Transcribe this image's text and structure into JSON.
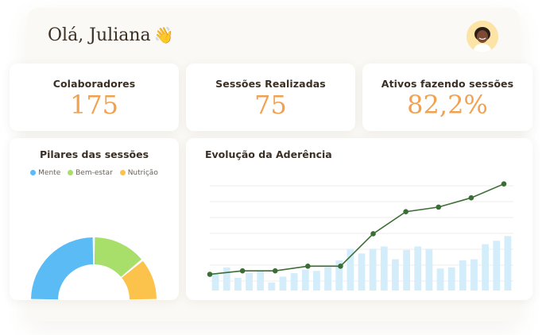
{
  "header": {
    "greeting": "Olá, Juliana",
    "wave_icon": "👋"
  },
  "kpis": [
    {
      "label": "Colaboradores",
      "value": "175"
    },
    {
      "label": "Sessões Realizadas",
      "value": "75"
    },
    {
      "label": "Ativos fazendo sessões",
      "value": "82,2%"
    }
  ],
  "pilares": {
    "title": "Pilares das sessões",
    "legend": [
      {
        "label": "Mente",
        "color": "#5bbcf5"
      },
      {
        "label": "Bem-estar",
        "color": "#a8df6b"
      },
      {
        "label": "Nutrição",
        "color": "#fcc34c"
      }
    ]
  },
  "evolucao": {
    "title": "Evolução da Aderência"
  },
  "chart_data": [
    {
      "type": "pie",
      "title": "Pilares das sessões",
      "variant": "half-donut",
      "labels": [
        "Mente",
        "Bem-estar",
        "Nutrição"
      ],
      "values": [
        50,
        28,
        22
      ],
      "colors": [
        "#5bbcf5",
        "#a8df6b",
        "#fcc34c"
      ],
      "legend": "top"
    },
    {
      "type": "line",
      "title": "Evolução da Aderência",
      "x": [
        1,
        2,
        3,
        4,
        5,
        6,
        7,
        8,
        9,
        10
      ],
      "series": [
        {
          "values": [
            14,
            17,
            17,
            21,
            21,
            49,
            68,
            72,
            80,
            92
          ]
        }
      ],
      "bars": [
        14,
        20,
        11,
        15,
        17,
        7,
        12,
        15,
        18,
        17,
        20,
        26,
        36,
        32,
        36,
        38,
        27,
        35,
        38,
        36,
        19,
        20,
        26,
        27,
        40,
        43,
        47
      ],
      "ylim": [
        0,
        100
      ],
      "grid": true,
      "line_color": "#3b6e35",
      "bar_color": "#d4edfb"
    }
  ]
}
